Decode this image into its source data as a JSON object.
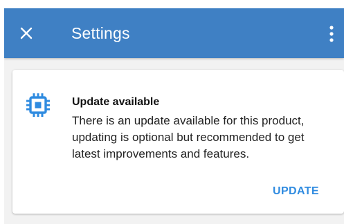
{
  "app_bar": {
    "title": "Settings",
    "close_icon": "close-icon",
    "overflow_icon": "more-vertical-icon",
    "background_color": "#3f80c4"
  },
  "update_card": {
    "icon": "chip-icon",
    "icon_color": "#2f8be0",
    "title": "Update available",
    "message": "There is an update available for this product, updating is optional but recommended to get latest improvements and features.",
    "action_label": "UPDATE",
    "action_color": "#2f8be0"
  }
}
